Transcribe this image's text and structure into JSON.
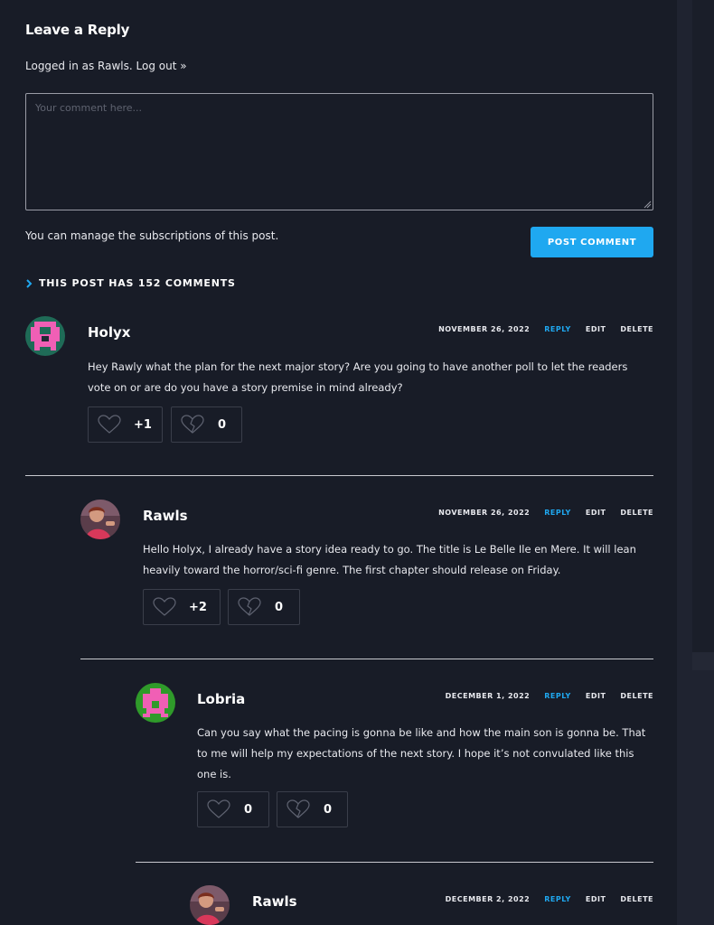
{
  "form": {
    "title": "Leave a Reply",
    "logged_in_as": "Logged in as Rawls. Log out »",
    "placeholder": "Your comment here...",
    "manage_text": "You can manage the subscriptions of this post.",
    "submit_label": "POST COMMENT"
  },
  "comments_header": "THIS POST HAS 152 COMMENTS",
  "actions": {
    "reply": "REPLY",
    "edit": "EDIT",
    "delete": "DELETE"
  },
  "comments": [
    {
      "author": "Holyx",
      "date": "NOVEMBER 26, 2022",
      "text": "Hey Rawly what the plan for the next major story? Are you going to have another poll to let the readers vote on or are do you have a story premise in mind already?",
      "likes": "+1",
      "dislikes": "0",
      "avatar": "pink-pixel-identicon"
    },
    {
      "author": "Rawls",
      "date": "NOVEMBER 26, 2022",
      "text": "Hello Holyx, I already have a story idea ready to go. The title is Le Belle Ile en Mere. It will lean heavily toward the horror/sci-fi genre. The first chapter should release on Friday.",
      "likes": "+2",
      "dislikes": "0",
      "avatar": "user-photo"
    },
    {
      "author": "Lobria",
      "date": "DECEMBER 1, 2022",
      "text": "Can you say what the pacing is gonna be like and how the main son is gonna be. That to me will help my expectations of the next story. I hope it’s not convulated like this one is.",
      "likes": "0",
      "dislikes": "0",
      "avatar": "green-pixel-identicon"
    },
    {
      "author": "Rawls",
      "date": "DECEMBER 2, 2022",
      "avatar": "user-photo"
    }
  ],
  "colors": {
    "accent": "#1fa8f0",
    "background": "#181c27",
    "border": "#3a3e4a"
  }
}
